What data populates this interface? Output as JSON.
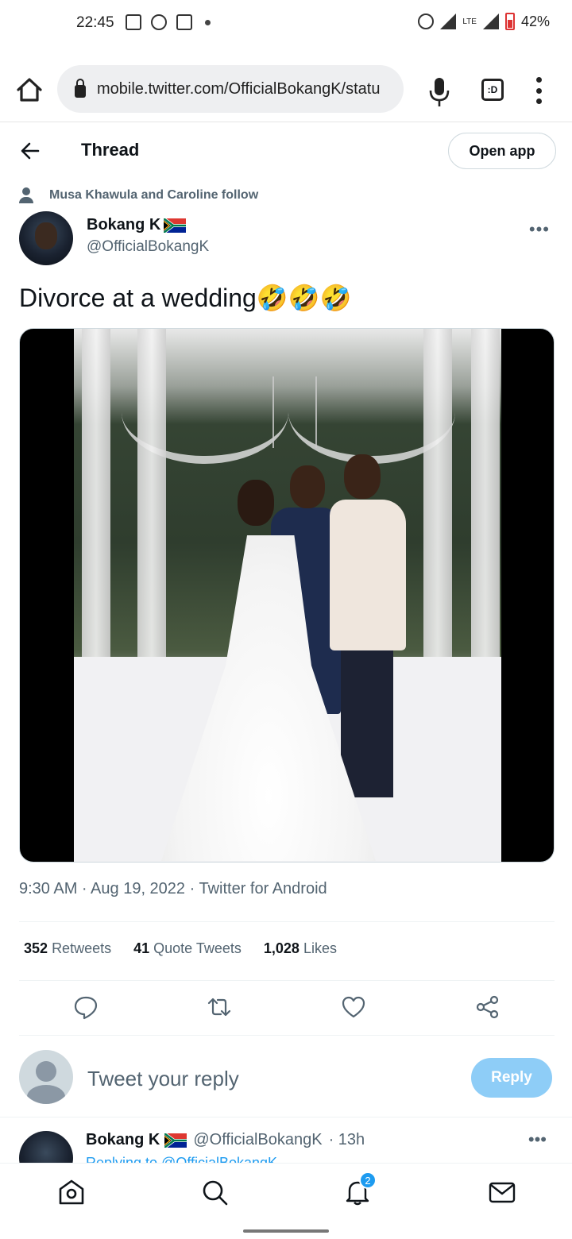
{
  "status_bar": {
    "time": "22:45",
    "battery": "42%",
    "network": "LTE"
  },
  "browser": {
    "url": "mobile.twitter.com/OfficialBokangK/statu",
    "tab_label": ":D"
  },
  "header": {
    "title": "Thread",
    "open_app": "Open app"
  },
  "social_context": "Musa Khawula and Caroline follow",
  "tweet": {
    "author_name": "Bokang K",
    "author_handle": "@OfficialBokangK",
    "text": "Divorce at a wedding🤣🤣🤣",
    "timestamp": "9:30 AM · Aug 19, 2022 · Twitter for Android",
    "stats": {
      "retweets_count": "352",
      "retweets_label": "Retweets",
      "quotes_count": "41",
      "quotes_label": "Quote Tweets",
      "likes_count": "1,028",
      "likes_label": "Likes"
    }
  },
  "reply_box": {
    "placeholder": "Tweet your reply",
    "button": "Reply"
  },
  "next_tweet": {
    "author_name": "Bokang K",
    "author_handle": "@OfficialBokangK",
    "time": "· 13h",
    "sub": "Replying to @OfficialBokangK"
  },
  "bottom_nav": {
    "notification_badge": "2"
  },
  "colors": {
    "accent": "#1d9bf0",
    "reply_button": "#8ecdf7",
    "secondary_text": "#536471"
  }
}
